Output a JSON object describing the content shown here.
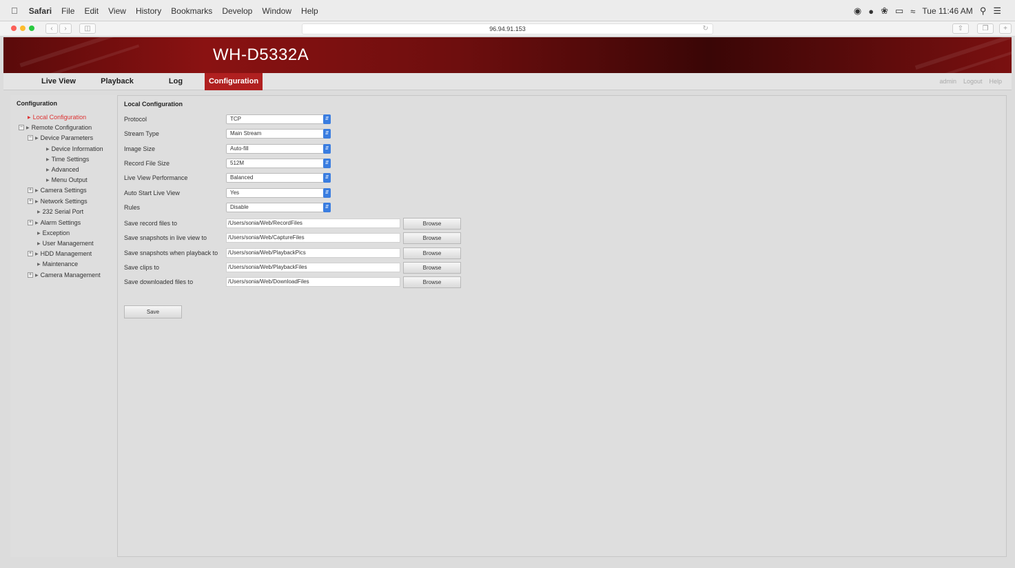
{
  "menubar": {
    "app": "Safari",
    "items": [
      "File",
      "Edit",
      "View",
      "History",
      "Bookmarks",
      "Develop",
      "Window",
      "Help"
    ],
    "clock": "Tue 11:46 AM"
  },
  "browser": {
    "url": "96.94.91.153"
  },
  "header": {
    "title": "WH-D5332A"
  },
  "nav": {
    "tabs": [
      "Live View",
      "Playback",
      "Log",
      "Configuration"
    ],
    "active": "Configuration",
    "user_links": [
      "admin",
      "Logout",
      "Help"
    ]
  },
  "sidebar": {
    "heading": "Configuration",
    "items": [
      "Local Configuration",
      "Remote Configuration",
      "Device Parameters",
      "Device Information",
      "Time Settings",
      "Advanced",
      "Menu Output",
      "Camera Settings",
      "Network Settings",
      "232 Serial Port",
      "Alarm Settings",
      "Exception",
      "User Management",
      "HDD Management",
      "Maintenance",
      "Camera Management"
    ]
  },
  "main": {
    "title": "Local Configuration",
    "settings": [
      {
        "label": "Protocol",
        "value": "TCP"
      },
      {
        "label": "Stream Type",
        "value": "Main Stream"
      },
      {
        "label": "Image Size",
        "value": "Auto-fill"
      },
      {
        "label": "Record File Size",
        "value": "512M"
      },
      {
        "label": "Live View Performance",
        "value": "Balanced"
      },
      {
        "label": "Auto Start Live View",
        "value": "Yes"
      },
      {
        "label": "Rules",
        "value": "Disable"
      }
    ],
    "paths": [
      {
        "label": "Save record files to",
        "value": "/Users/sonia/Web/RecordFiles",
        "button": "Browse"
      },
      {
        "label": "Save snapshots in live view to",
        "value": "/Users/sonia/Web/CaptureFiles",
        "button": "Browse"
      },
      {
        "label": "Save snapshots when playback to",
        "value": "/Users/sonia/Web/PlaybackPics",
        "button": "Browse"
      },
      {
        "label": "Save clips to",
        "value": "/Users/sonia/Web/PlaybackFiles",
        "button": "Browse"
      },
      {
        "label": "Save downloaded files to",
        "value": "/Users/sonia/Web/DownloadFiles",
        "button": "Browse"
      }
    ],
    "save_label": "Save"
  }
}
